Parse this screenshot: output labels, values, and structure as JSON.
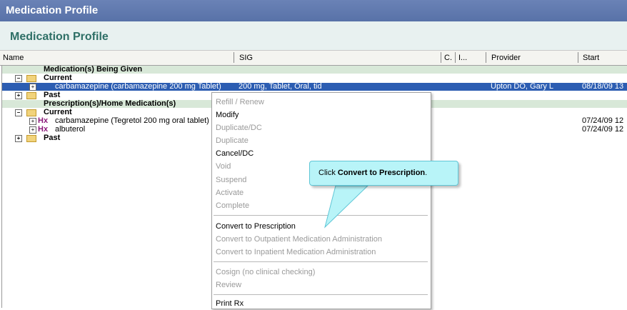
{
  "window": {
    "title": "Medication Profile"
  },
  "subtitle": "Medication Profile",
  "columns": {
    "name": "Name",
    "sig": "SIG",
    "c": "C.",
    "i": "I...",
    "provider": "Provider",
    "start": "Start"
  },
  "rows": {
    "group1": "Medication(s) Being Given",
    "current1": "Current",
    "med1_name": "carbamazepine (carbamazepine 200 mg Tablet)",
    "med1_sig": "200 mg, Tablet, Oral, tid",
    "med1_provider": "Upton DO, Gary L",
    "med1_start": "08/18/09 13",
    "past1": "Past",
    "group2": "Prescription(s)/Home Medication(s)",
    "current2": "Current",
    "hx": "Hx",
    "med2_name": "carbamazepine (Tegretol 200 mg oral tablet)",
    "med2_start": "07/24/09 12",
    "med3_name": "albuterol",
    "med3_start": "07/24/09 12",
    "past2": "Past"
  },
  "menu": {
    "refill": "Refill / Renew",
    "modify": "Modify",
    "duplicate_dc": "Duplicate/DC",
    "duplicate": "Duplicate",
    "cancel_dc": "Cancel/DC",
    "void": "Void",
    "suspend": "Suspend",
    "activate": "Activate",
    "complete": "Complete",
    "convert_rx": "Convert to Prescription",
    "convert_outpatient": "Convert to Outpatient Medication Administration",
    "convert_inpatient": "Convert to Inpatient Medication Administration",
    "cosign": "Cosign (no clinical checking)",
    "review": "Review",
    "print_rx": "Print Rx"
  },
  "callout": {
    "prefix": "Click ",
    "bold": "Convert to Prescription",
    "suffix": "."
  },
  "colors": {
    "title_bar": "#5872a8",
    "selected_row": "#2c5db2",
    "group_row": "#d8e8d8",
    "callout_bg": "#b8f4f8"
  }
}
